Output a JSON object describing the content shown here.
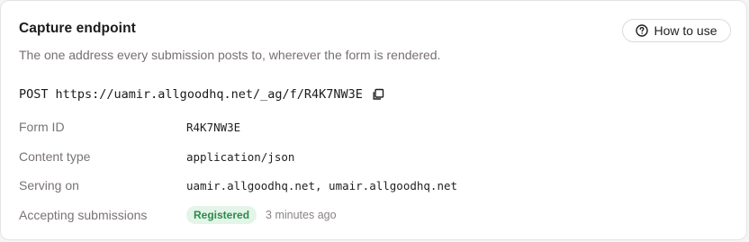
{
  "card": {
    "title": "Capture endpoint",
    "subtitle": "The one address every submission posts to, wherever the form is rendered.",
    "help_button": {
      "label": "How to use",
      "icon": "question-circle-icon"
    }
  },
  "endpoint": {
    "method": "POST",
    "url": "https://uamir.allgoodhq.net/_ag/f/R4K7NW3E",
    "copy_icon": "copy-icon"
  },
  "details": {
    "form_id": {
      "label": "Form ID",
      "value": "R4K7NW3E"
    },
    "content_type": {
      "label": "Content type",
      "value": "application/json"
    },
    "serving_on": {
      "label": "Serving on",
      "value": "uamir.allgoodhq.net, umair.allgoodhq.net"
    },
    "accepting": {
      "label": "Accepting submissions",
      "status": "Registered",
      "time": "3 minutes ago"
    }
  },
  "colors": {
    "badge_bg": "#e3f4e8",
    "badge_text": "#2f8a4a",
    "muted_text": "#77706f"
  }
}
